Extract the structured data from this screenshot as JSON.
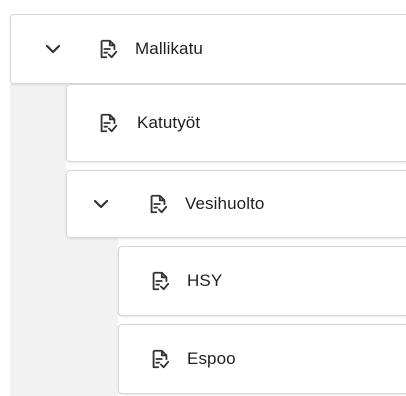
{
  "tree": {
    "items": [
      {
        "label": "Mallikatu",
        "expanded": true,
        "icon": "document-check-icon"
      },
      {
        "label": "Katutyöt",
        "icon": "document-check-icon"
      },
      {
        "label": "Vesihuolto",
        "expanded": true,
        "icon": "document-check-icon"
      },
      {
        "label": "HSY",
        "icon": "document-check-icon"
      },
      {
        "label": "Espoo",
        "icon": "document-check-icon"
      }
    ]
  },
  "colors": {
    "text": "#1f1f1f",
    "icon": "#333333",
    "border": "#d6d6d6",
    "gutter": "#f2f2f2"
  }
}
